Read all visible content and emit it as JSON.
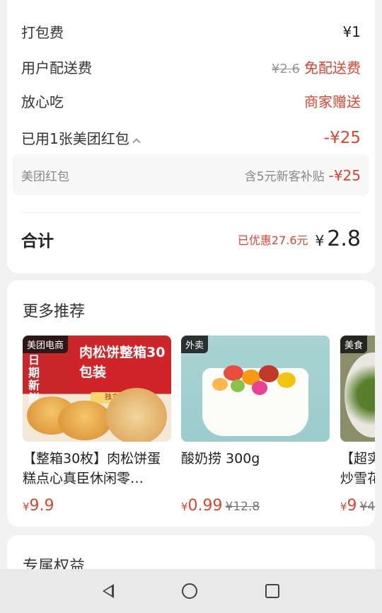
{
  "fees": {
    "packing": {
      "label": "打包费",
      "value": "¥1"
    },
    "delivery": {
      "label": "用户配送费",
      "original": "¥2.6",
      "value": "免配送费"
    },
    "fangxin": {
      "label": "放心吃",
      "value": "商家赠送"
    },
    "coupon": {
      "label": "已用1张美团红包",
      "value": "-¥25"
    },
    "coupon_detail": {
      "label": "美团红包",
      "note": "含5元新客补贴",
      "value": "-¥25"
    }
  },
  "total": {
    "label": "合计",
    "discount": "已优惠27.6元",
    "currency": "¥",
    "amount": "2.8"
  },
  "recommend": {
    "title": "更多推荐",
    "products": [
      {
        "tag": "美团电商",
        "name": "【整箱30枚】肉松饼蛋糕点心真臣休闲零…",
        "yen": "¥",
        "price": "9.9",
        "old": "",
        "banner": "肉松饼整箱30包装",
        "vertical": "日期新鲜",
        "pack": "独立包装"
      },
      {
        "tag": "外卖",
        "name": "酸奶捞 300g",
        "yen": "¥",
        "price": "0.99",
        "old": "¥12.8"
      },
      {
        "tag": "美食",
        "name": "【超实炒雪花",
        "yen": "¥",
        "price": "9",
        "old": "¥4"
      }
    ]
  },
  "benefits": {
    "title": "专属权益"
  }
}
